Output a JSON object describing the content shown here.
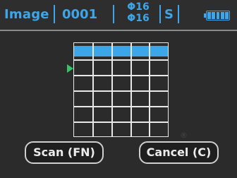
{
  "header": {
    "title": "Image",
    "number": "0001",
    "phi_top": "Φ16",
    "phi_bottom": "Φ16",
    "mode": "S",
    "battery_level": 1.0,
    "accent_color": "#3ea6e8"
  },
  "grid": {
    "rows": 6,
    "columns": 5,
    "highlighted_row": 1,
    "highlight_color": "#3ea6e8",
    "pointer_color": "#36c46a"
  },
  "buttons": {
    "scan_label": "Scan (FN)",
    "cancel_label": "Cancel (C)"
  }
}
